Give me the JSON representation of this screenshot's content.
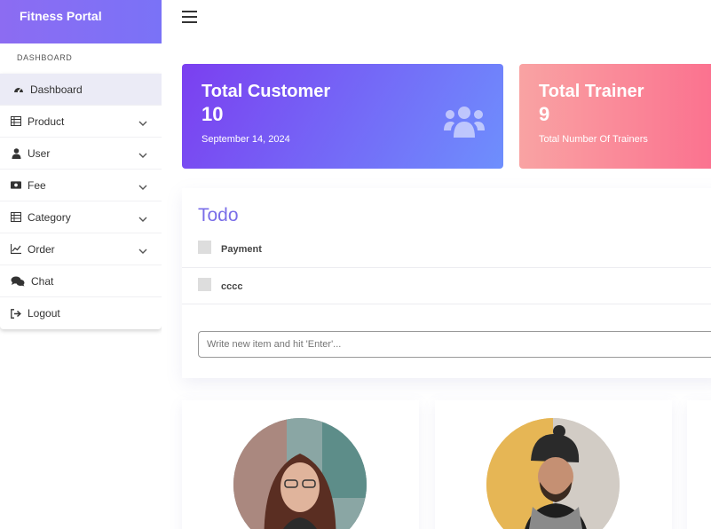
{
  "app": {
    "title": "Fitness Portal"
  },
  "sidebar": {
    "section_label": "DASHBOARD",
    "items": [
      {
        "label": "Dashboard",
        "icon": "gauge-icon",
        "active": true
      },
      {
        "label": "Product",
        "icon": "table-icon",
        "expandable": true
      },
      {
        "label": "User",
        "icon": "user-icon",
        "expandable": true
      },
      {
        "label": "Fee",
        "icon": "money-icon",
        "expandable": true
      },
      {
        "label": "Category",
        "icon": "table-icon",
        "expandable": true
      },
      {
        "label": "Order",
        "icon": "line-chart-icon",
        "expandable": true
      },
      {
        "label": "Chat",
        "icon": "comments-icon"
      },
      {
        "label": "Logout",
        "icon": "sign-out-icon"
      }
    ]
  },
  "cards": {
    "customer": {
      "title": "Total Customer",
      "value": "10",
      "subtitle": "September 14, 2024",
      "icon": "users-icon"
    },
    "trainer": {
      "title": "Total Trainer",
      "value": "9",
      "subtitle": "Total Number Of Trainers"
    }
  },
  "todo": {
    "title": "Todo",
    "items": [
      {
        "text": "Payment",
        "checked": false
      },
      {
        "text": "cccc",
        "checked": false
      }
    ],
    "input_placeholder": "Write new item and hit 'Enter'..."
  },
  "colors": {
    "brand": "#8c6cf2",
    "customer_card_start": "#7b3ff0",
    "customer_card_end": "#6e8ffd",
    "trainer_card_start": "#f9a3a3",
    "trainer_card_end": "#fb6f8e",
    "todo_title": "#7a6ee8"
  }
}
